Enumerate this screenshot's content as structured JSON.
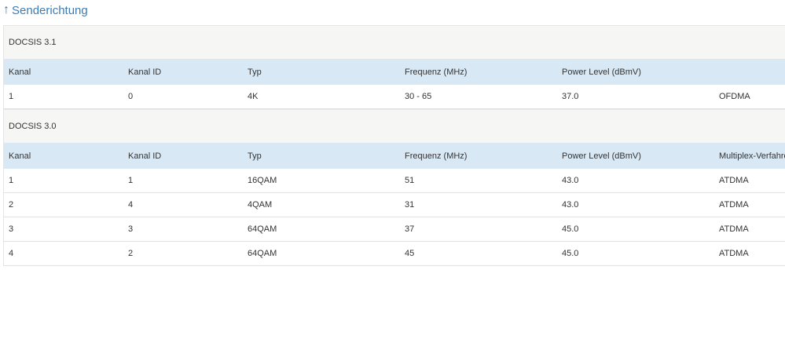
{
  "section": {
    "arrow": "↑",
    "title": "Senderichtung"
  },
  "docsis31": {
    "title": "DOCSIS 3.1",
    "headers": [
      "Kanal",
      "Kanal ID",
      "Typ",
      "Frequenz (MHz)",
      "Power Level (dBmV)",
      ""
    ],
    "rows": [
      [
        "1",
        "0",
        "4K",
        "30 - 65",
        "37.0",
        "OFDMA"
      ]
    ]
  },
  "docsis30": {
    "title": "DOCSIS 3.0",
    "headers": [
      "Kanal",
      "Kanal ID",
      "Typ",
      "Frequenz (MHz)",
      "Power Level (dBmV)",
      "Multiplex-Verfahren"
    ],
    "rows": [
      [
        "1",
        "1",
        "16QAM",
        "51",
        "43.0",
        "ATDMA"
      ],
      [
        "2",
        "4",
        "4QAM",
        "31",
        "43.0",
        "ATDMA"
      ],
      [
        "3",
        "3",
        "64QAM",
        "37",
        "45.0",
        "ATDMA"
      ],
      [
        "4",
        "2",
        "64QAM",
        "45",
        "45.0",
        "ATDMA"
      ]
    ]
  }
}
